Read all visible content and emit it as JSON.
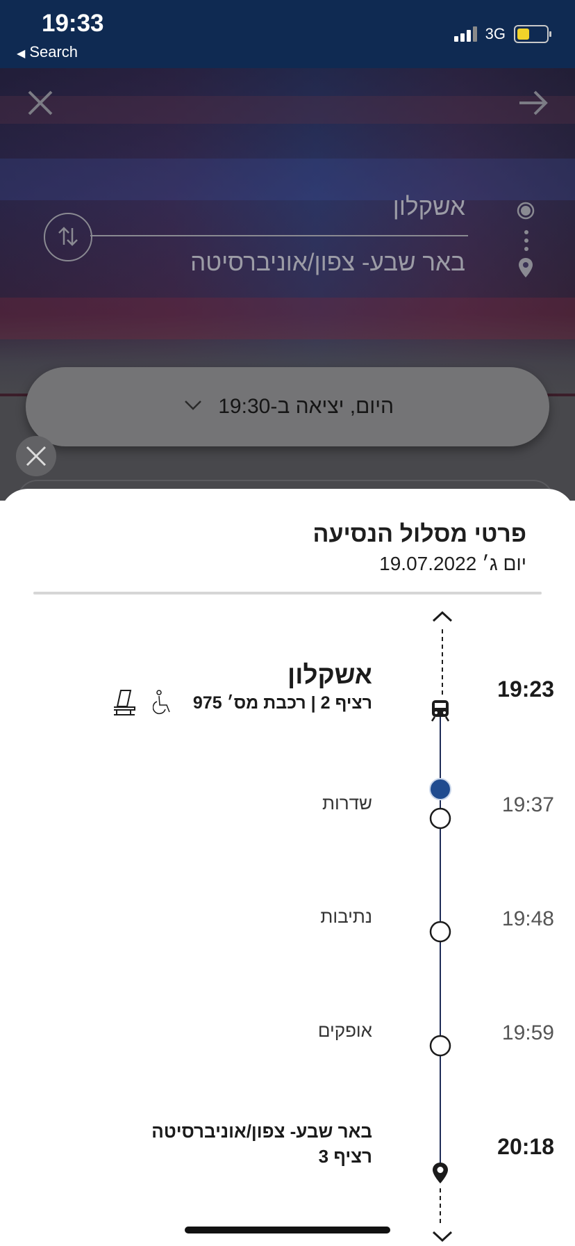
{
  "status_bar": {
    "time": "19:33",
    "back_label": "Search",
    "network": "3G",
    "signal_icon": "cellular-signal-icon",
    "battery_icon": "battery-icon"
  },
  "route": {
    "from": "אשקלון",
    "to": "באר שבע- צפון/אוניברסיטה"
  },
  "date_selector": {
    "label": "היום, יציאה ב-19:30"
  },
  "sheet": {
    "title": "פרטי מסלול הנסיעה",
    "date": "יום ג׳ 19.07.2022"
  },
  "stops": [
    {
      "time": "19:23",
      "name": "אשקלון",
      "subtitle": "רציף 2 | רכבת מס׳ 975",
      "type": "origin",
      "icon": "train-icon"
    },
    {
      "time": "19:37",
      "name": "שדרות",
      "type": "intermediate"
    },
    {
      "time": "19:48",
      "name": "נתיבות",
      "type": "intermediate"
    },
    {
      "time": "19:59",
      "name": "אופקים",
      "type": "intermediate"
    },
    {
      "time": "20:18",
      "name": "באר שבע- צפון/אוניברסיטה",
      "subtitle": "רציף 3",
      "type": "destination",
      "icon": "location-pin-icon"
    }
  ],
  "colors": {
    "status_bar": "#0f2a52",
    "timeline": "#1d2b55",
    "current_position": "#1f4b8f"
  }
}
